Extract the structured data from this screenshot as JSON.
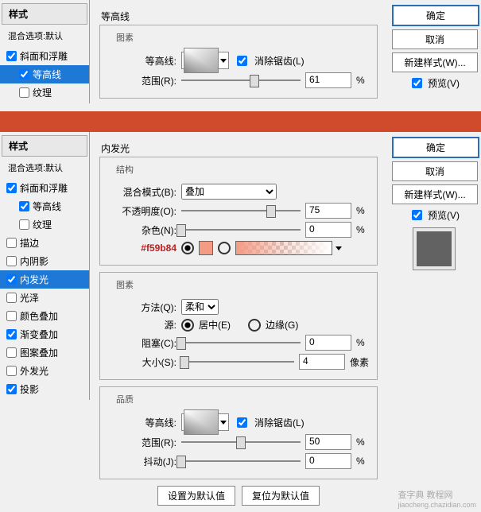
{
  "top": {
    "left": {
      "header": "样式",
      "blend": "混合选项:默认",
      "items": [
        {
          "label": "斜面和浮雕",
          "checked": true,
          "sel": false,
          "indent": false
        },
        {
          "label": "等高线",
          "checked": true,
          "sel": true,
          "indent": true
        },
        {
          "label": "纹理",
          "checked": false,
          "sel": false,
          "indent": true
        }
      ]
    },
    "mid": {
      "outer_title": "等高线",
      "fs_title": "图素",
      "contour_label": "等高线:",
      "antialias": "消除锯齿(L)",
      "range_label": "范围(R):",
      "range_val": "61",
      "pct": "%"
    },
    "right": {
      "ok": "确定",
      "cancel": "取消",
      "newstyle": "新建样式(W)...",
      "preview": "预览(V)"
    }
  },
  "bottom": {
    "left": {
      "header": "样式",
      "blend": "混合选项:默认",
      "items": [
        {
          "label": "斜面和浮雕",
          "checked": true
        },
        {
          "label": "等高线",
          "checked": true,
          "indent": true
        },
        {
          "label": "纹理",
          "checked": false,
          "indent": true
        },
        {
          "label": "描边",
          "checked": false
        },
        {
          "label": "内阴影",
          "checked": false
        },
        {
          "label": "内发光",
          "checked": true,
          "sel": true
        },
        {
          "label": "光泽",
          "checked": false
        },
        {
          "label": "颜色叠加",
          "checked": false
        },
        {
          "label": "渐变叠加",
          "checked": true
        },
        {
          "label": "图案叠加",
          "checked": false
        },
        {
          "label": "外发光",
          "checked": false
        },
        {
          "label": "投影",
          "checked": true
        }
      ]
    },
    "mid": {
      "outer_title": "内发光",
      "fs1": "结构",
      "blend_mode_label": "混合模式(B):",
      "blend_mode_val": "叠加",
      "opacity_label": "不透明度(O):",
      "opacity_val": "75",
      "pct": "%",
      "noise_label": "杂色(N):",
      "noise_val": "0",
      "hex": "#f59b84",
      "fs2": "图素",
      "tech_label": "方法(Q):",
      "tech_val": "柔和",
      "source_label": "源:",
      "center": "居中(E)",
      "edge": "边缘(G)",
      "choke_label": "阻塞(C):",
      "choke_val": "0",
      "size_label": "大小(S):",
      "size_val": "4",
      "size_unit": "像素",
      "fs3": "品质",
      "contour_label": "等高线:",
      "antialias": "消除锯齿(L)",
      "range_label": "范围(R):",
      "range_val": "50",
      "jitter_label": "抖动(J):",
      "jitter_val": "0",
      "default_btn": "设置为默认值",
      "reset_btn": "复位为默认值"
    },
    "right": {
      "ok": "确定",
      "cancel": "取消",
      "newstyle": "新建样式(W)...",
      "preview": "预览(V)"
    }
  },
  "watermark": "查字典 教程网",
  "watermark2": "jiaocheng.chazidian.com"
}
